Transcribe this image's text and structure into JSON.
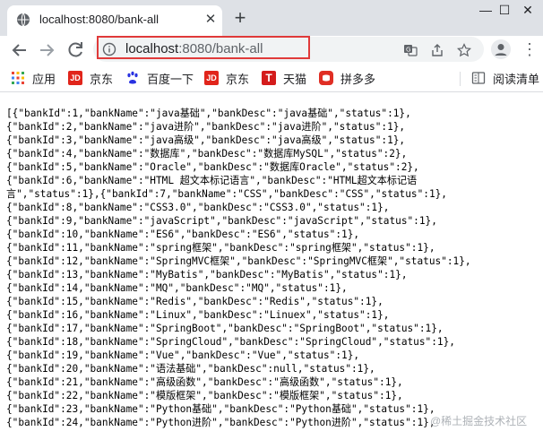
{
  "colors": {
    "tabstrip": "#dee1e6",
    "url_highlight": "#e03a3a",
    "jd_red": "#e1251b",
    "tmall_red": "#d41c1c",
    "pdd_red": "#e02e24",
    "baidu_blue": "#2932e1"
  },
  "tab": {
    "title": "localhost:8080/bank-all",
    "favicon": "globe-icon",
    "close_label": "✕"
  },
  "window": {
    "newtab_label": "+",
    "minimize_label": "—",
    "maximize_label": "☐",
    "close_label": "✕"
  },
  "toolbar": {
    "back_icon": "arrow-left-icon",
    "forward_icon": "arrow-right-icon",
    "reload_icon": "reload-icon",
    "url_host": "localhost",
    "url_rest": ":8080/bank-all",
    "translate_icon": "translate-icon",
    "share_icon": "share-icon",
    "bookmark_star_icon": "star-icon",
    "profile_icon": "profile-avatar-icon",
    "menu_icon": "more-vertical-icon"
  },
  "bookmarks": {
    "items": [
      {
        "label": "应用",
        "icon": "apps-grid-icon"
      },
      {
        "label": "京东",
        "icon": "jd-icon"
      },
      {
        "label": "百度一下",
        "icon": "baidu-paw-icon"
      },
      {
        "label": "京东",
        "icon": "jd-icon"
      },
      {
        "label": "天猫",
        "icon": "tmall-icon"
      },
      {
        "label": "拼多多",
        "icon": "pinduoduo-icon"
      }
    ],
    "reading_list": "阅读清单",
    "reading_list_icon": "reading-list-icon"
  },
  "content": {
    "json_text": "[{\"bankId\":1,\"bankName\":\"java基础\",\"bankDesc\":\"java基础\",\"status\":1},\n{\"bankId\":2,\"bankName\":\"java进阶\",\"bankDesc\":\"java进阶\",\"status\":1},\n{\"bankId\":3,\"bankName\":\"java高级\",\"bankDesc\":\"java高级\",\"status\":1},\n{\"bankId\":4,\"bankName\":\"数据库\",\"bankDesc\":\"数据库MySQL\",\"status\":2},\n{\"bankId\":5,\"bankName\":\"Oracle\",\"bankDesc\":\"数据库Oracle\",\"status\":2},\n{\"bankId\":6,\"bankName\":\"HTML 超文本标记语言\",\"bankDesc\":\"HTML超文本标记语\n言\",\"status\":1},{\"bankId\":7,\"bankName\":\"CSS\",\"bankDesc\":\"CSS\",\"status\":1},\n{\"bankId\":8,\"bankName\":\"CSS3.0\",\"bankDesc\":\"CSS3.0\",\"status\":1},\n{\"bankId\":9,\"bankName\":\"javaScript\",\"bankDesc\":\"javaScript\",\"status\":1},\n{\"bankId\":10,\"bankName\":\"ES6\",\"bankDesc\":\"ES6\",\"status\":1},\n{\"bankId\":11,\"bankName\":\"spring框架\",\"bankDesc\":\"spring框架\",\"status\":1},\n{\"bankId\":12,\"bankName\":\"SpringMVC框架\",\"bankDesc\":\"SpringMVC框架\",\"status\":1},\n{\"bankId\":13,\"bankName\":\"MyBatis\",\"bankDesc\":\"MyBatis\",\"status\":1},\n{\"bankId\":14,\"bankName\":\"MQ\",\"bankDesc\":\"MQ\",\"status\":1},\n{\"bankId\":15,\"bankName\":\"Redis\",\"bankDesc\":\"Redis\",\"status\":1},\n{\"bankId\":16,\"bankName\":\"Linux\",\"bankDesc\":\"Linuex\",\"status\":1},\n{\"bankId\":17,\"bankName\":\"SpringBoot\",\"bankDesc\":\"SpringBoot\",\"status\":1},\n{\"bankId\":18,\"bankName\":\"SpringCloud\",\"bankDesc\":\"SpringCloud\",\"status\":1},\n{\"bankId\":19,\"bankName\":\"Vue\",\"bankDesc\":\"Vue\",\"status\":1},\n{\"bankId\":20,\"bankName\":\"语法基础\",\"bankDesc\":null,\"status\":1},\n{\"bankId\":21,\"bankName\":\"高级函数\",\"bankDesc\":\"高级函数\",\"status\":1},\n{\"bankId\":22,\"bankName\":\"模版框架\",\"bankDesc\":\"模版框架\",\"status\":1},\n{\"bankId\":23,\"bankName\":\"Python基础\",\"bankDesc\":\"Python基础\",\"status\":1},\n{\"bankId\":24,\"bankName\":\"Python进阶\",\"bankDesc\":\"Python进阶\",\"status\":1},"
  },
  "watermark": "@稀土掘金技术社区"
}
